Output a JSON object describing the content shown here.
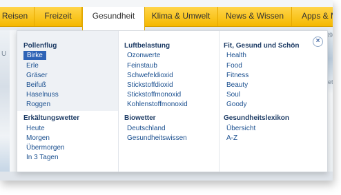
{
  "nav": {
    "tabs": [
      {
        "label": "Reisen"
      },
      {
        "label": "Freizeit"
      },
      {
        "label": "Gesundheit"
      },
      {
        "label": "Klima & Umwelt"
      },
      {
        "label": "News & Wissen"
      },
      {
        "label": "Apps & M"
      }
    ],
    "active_tab": "Gesundheit"
  },
  "background": {
    "left_glyph": "U",
    "right_top_glyph": "09",
    "right_mid_glyph": "eet"
  },
  "menu": {
    "close_label": "×",
    "columns": [
      {
        "sections": [
          {
            "title": "Pollenflug",
            "items": [
              "Birke",
              "Erle",
              "Gräser",
              "Beifuß",
              "Haselnuss",
              "Roggen"
            ],
            "selected": "Birke"
          },
          {
            "title": "Erkältungswetter",
            "items": [
              "Heute",
              "Morgen",
              "Übermorgen",
              "In 3 Tagen"
            ]
          }
        ]
      },
      {
        "sections": [
          {
            "title": "Luftbelastung",
            "items": [
              "Ozonwerte",
              "Feinstaub",
              "Schwefeldioxid",
              "Stickstoffdioxid",
              "Stickstoffmonoxid",
              "Kohlenstoffmonoxid"
            ]
          },
          {
            "title": "Biowetter",
            "items": [
              "Deutschland",
              "Gesundheitswissen"
            ]
          }
        ]
      },
      {
        "sections": [
          {
            "title": "Fit, Gesund und Schön",
            "items": [
              "Health",
              "Food",
              "Fitness",
              "Beauty",
              "Soul",
              "Goody"
            ]
          },
          {
            "title": "Gesundheitslexikon",
            "items": [
              "Übersicht",
              "A-Z"
            ]
          }
        ]
      }
    ]
  },
  "colors": {
    "nav_yellow": "#f5b800",
    "link_blue": "#1a4f8f",
    "heading_blue": "#1f3d66",
    "selected_bg": "#2e63b6"
  }
}
